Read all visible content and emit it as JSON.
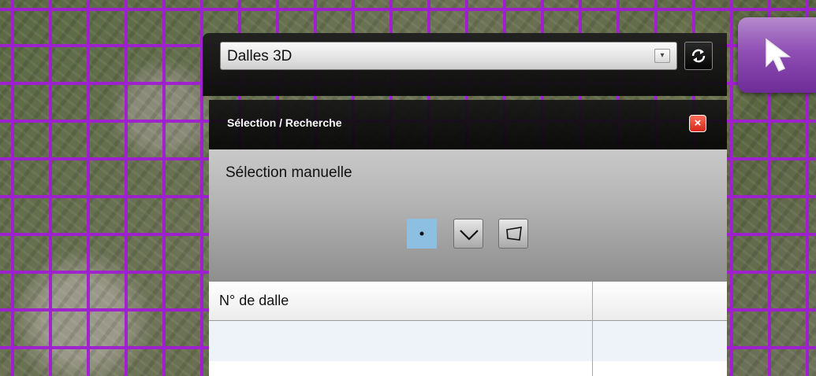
{
  "layer_selector": {
    "selected": "Dalles 3D",
    "dropdown_arrow": "▾",
    "sync_icon": "sync-icon"
  },
  "selection_panel": {
    "title": "Sélection / Recherche",
    "close_label": "×",
    "manual_label": "Sélection manuelle",
    "tools": [
      "point-select-icon",
      "line-select-icon",
      "polygon-select-icon"
    ]
  },
  "results_table": {
    "columns": [
      "N° de dalle",
      ""
    ],
    "rows": [
      [
        "",
        ""
      ],
      [
        "",
        ""
      ]
    ]
  },
  "colors": {
    "grid": "#a01ed2",
    "active_tool": "#8cbfe1",
    "close": "#d8261a",
    "pointer_button": "#8f4fb4"
  }
}
